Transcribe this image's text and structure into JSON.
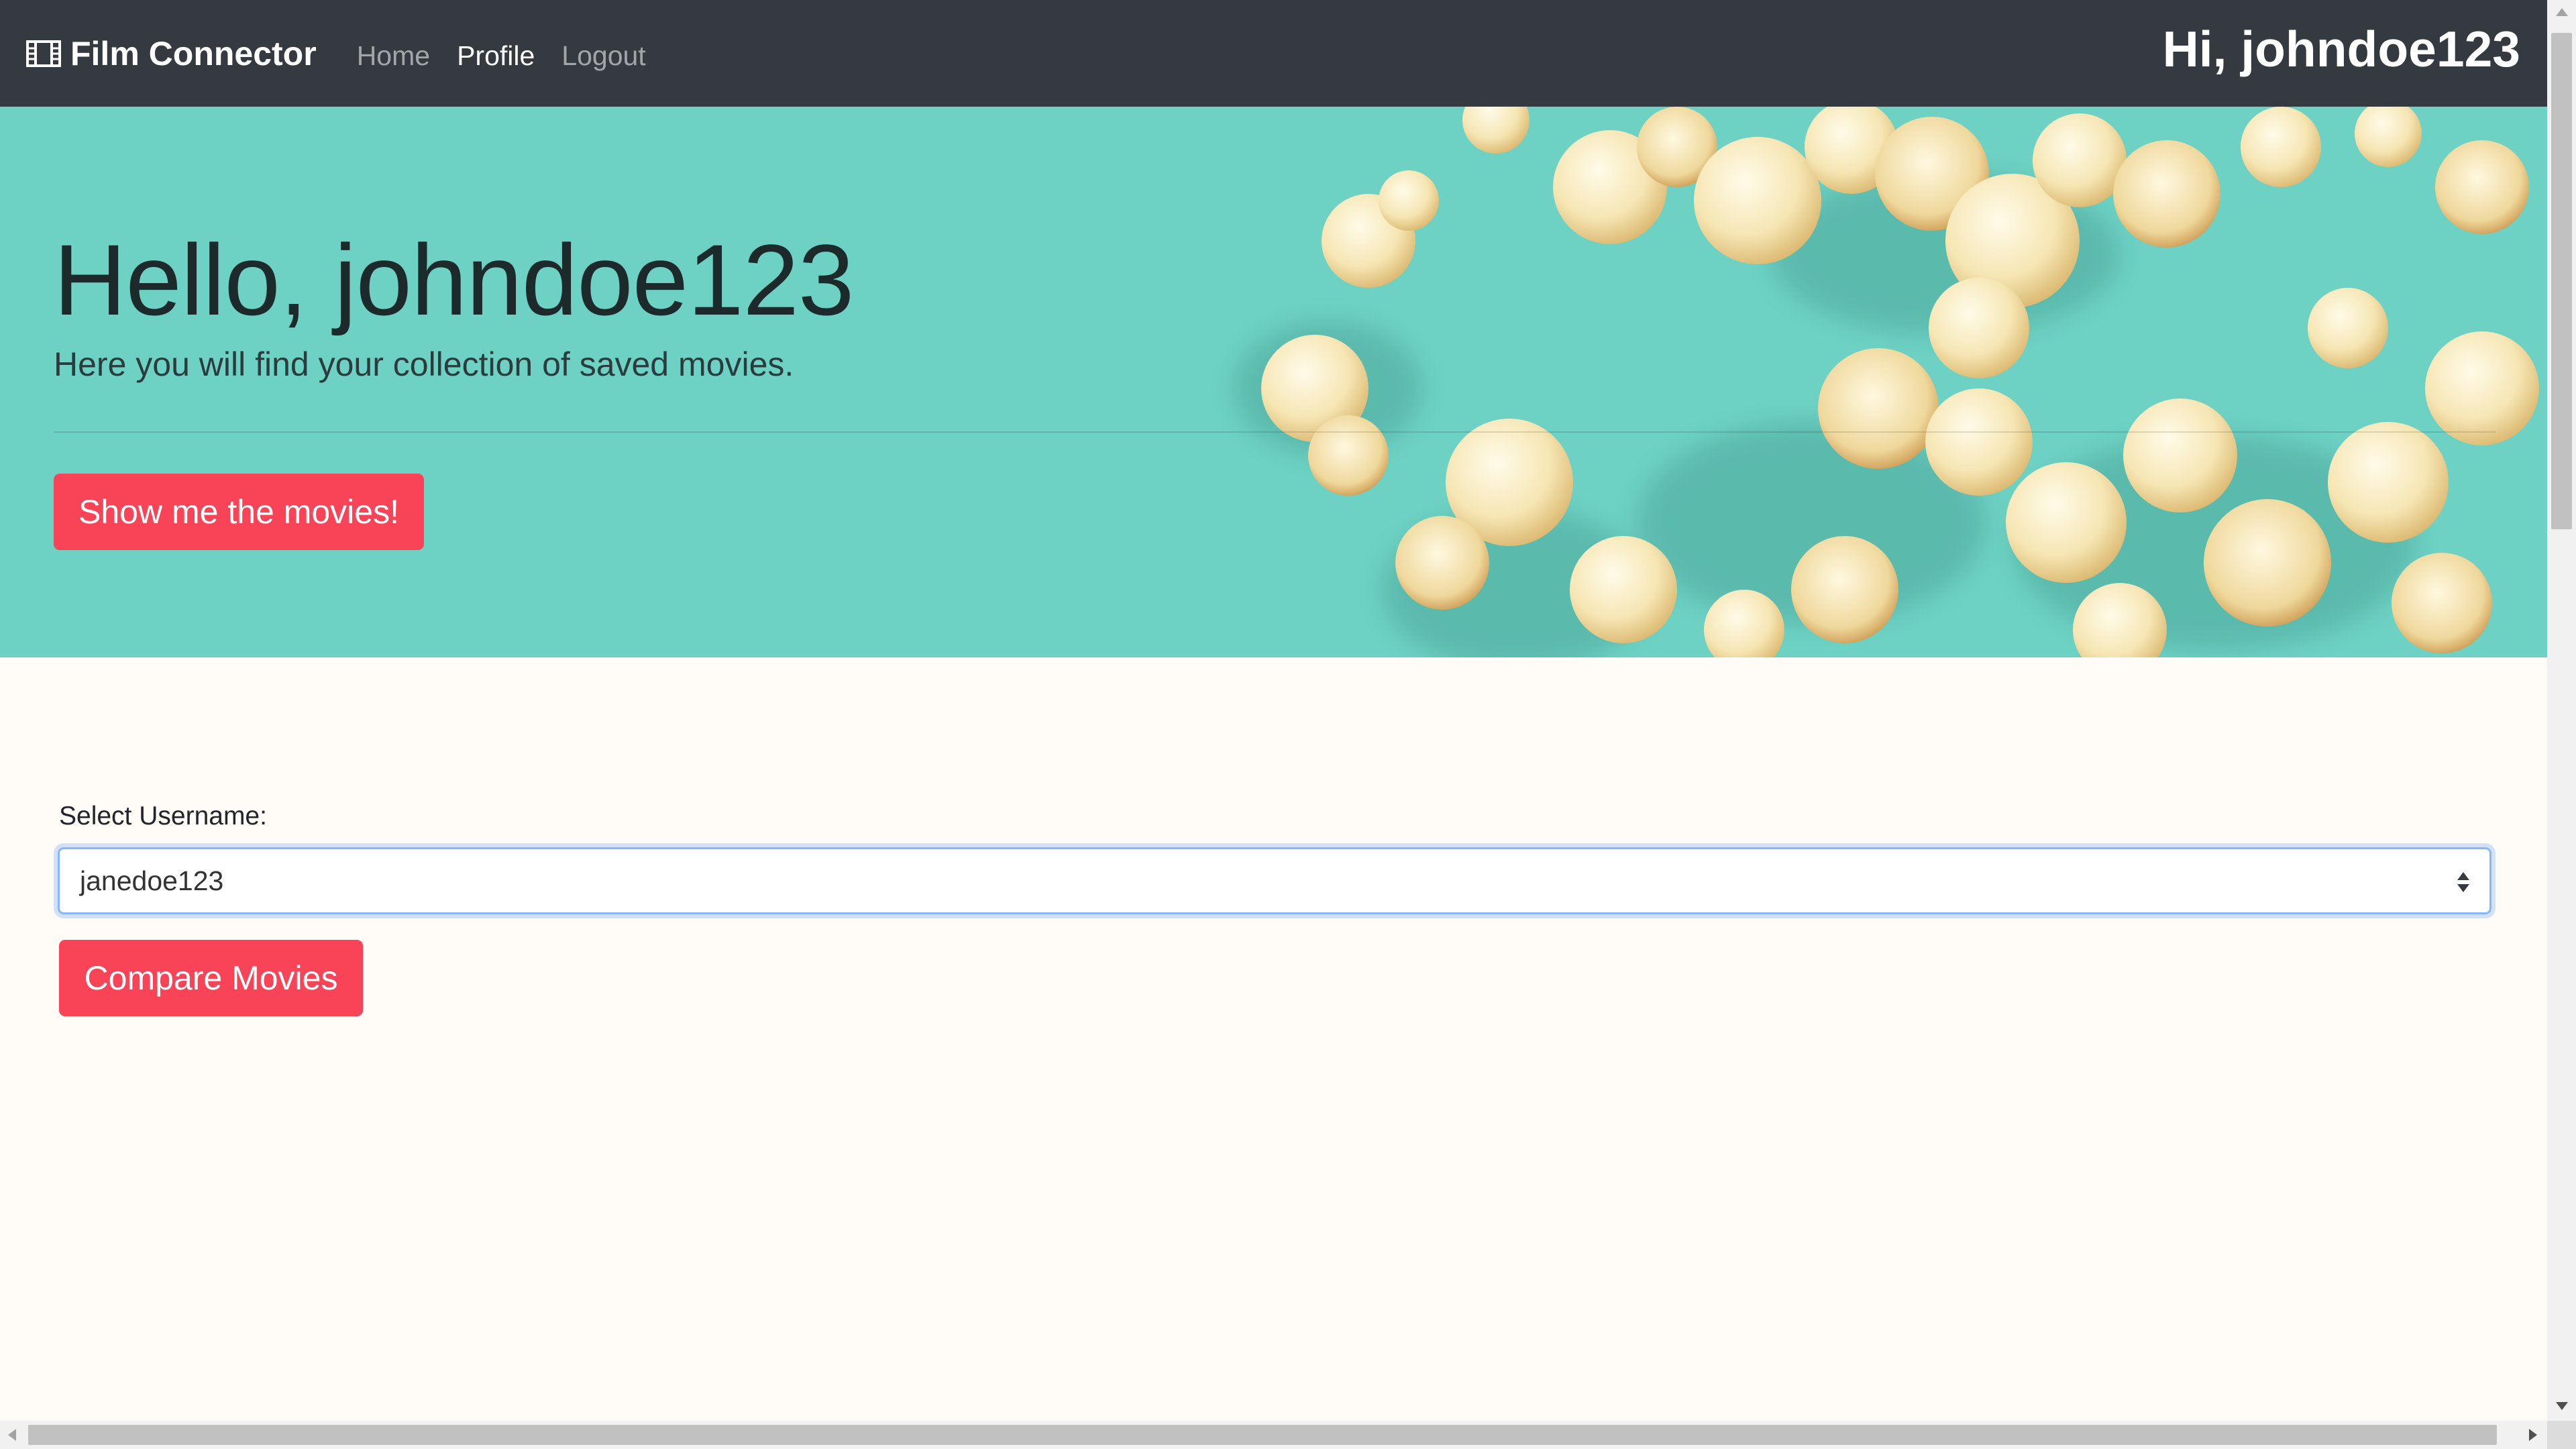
{
  "navbar": {
    "brand": "Film Connector",
    "brand_icon": "film-icon",
    "links": [
      "Home",
      "Profile",
      "Logout"
    ],
    "active_link": "Profile",
    "greeting": "Hi, johndoe123"
  },
  "hero": {
    "title": "Hello, johndoe123",
    "subtitle": "Here you will find your collection of saved movies.",
    "button_label": "Show me the movies!",
    "background_color": "#6dd1c3"
  },
  "form": {
    "label": "Select Username:",
    "selected_value": "janedoe123",
    "compare_button_label": "Compare Movies"
  },
  "colors": {
    "navbar_bg": "#343a40",
    "accent": "#f94458",
    "page_bg": "#fffbf6"
  }
}
